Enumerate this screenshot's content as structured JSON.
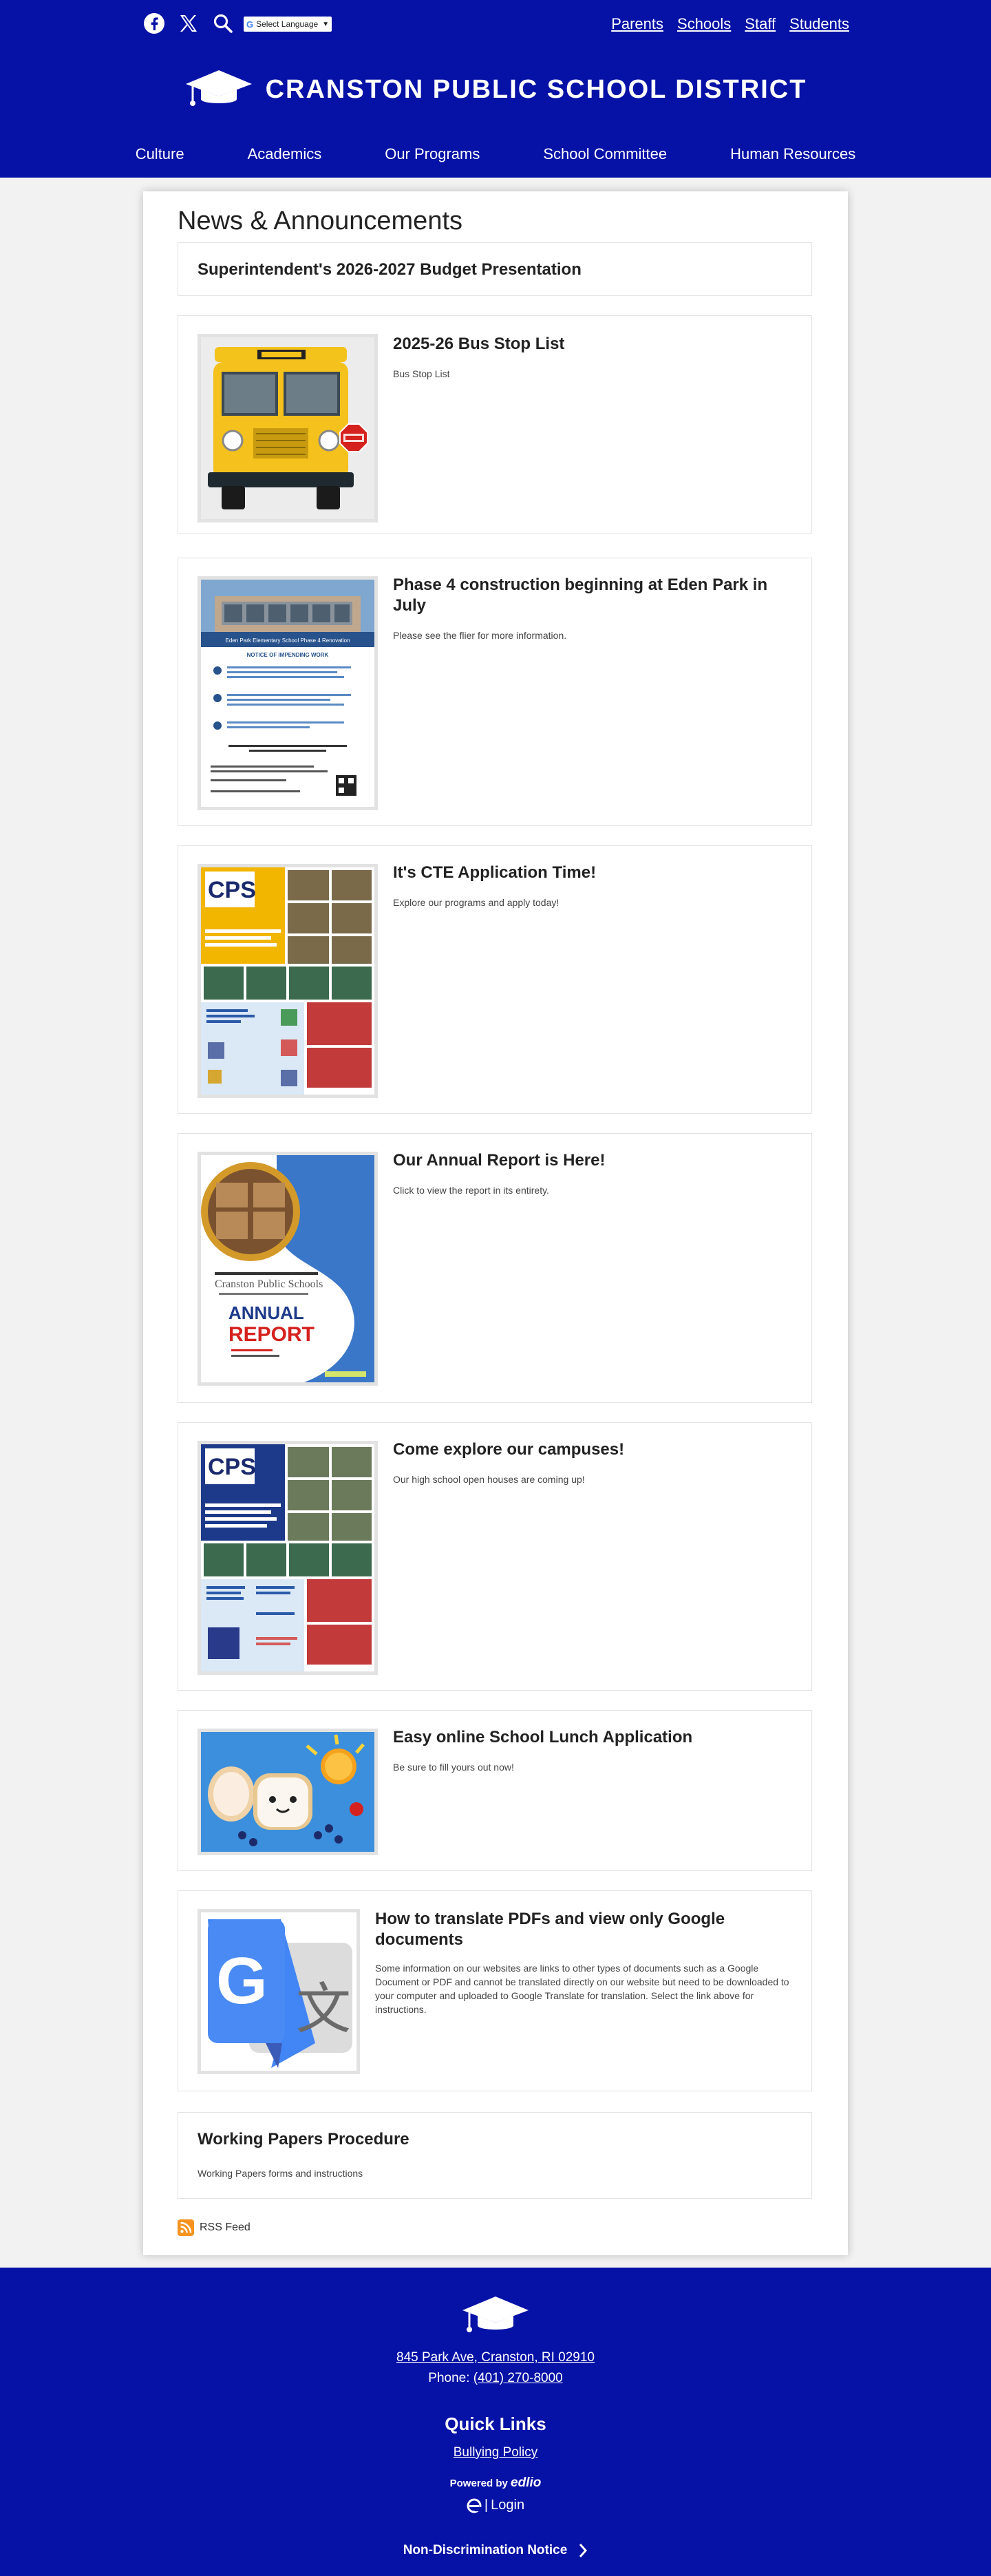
{
  "header": {
    "social": [
      {
        "icon": "facebook-icon"
      },
      {
        "icon": "x-twitter-icon"
      },
      {
        "icon": "search-icon"
      }
    ],
    "translate": {
      "label": "Select Language",
      "icon": "google-translate-icon"
    },
    "top_links": [
      "Parents",
      "Schools",
      "Staff",
      "Students"
    ],
    "title": "CRANSTON PUBLIC SCHOOL DISTRICT",
    "nav": [
      "Culture",
      "Academics",
      "Our Programs",
      "School Committee",
      "Human Resources"
    ],
    "colors": {
      "brand_blue": "#0611a6",
      "white": "#ffffff"
    }
  },
  "main": {
    "title": "News & Announcements",
    "items": [
      {
        "title": "Superintendent's 2026-2027 Budget Presentation",
        "desc": ""
      },
      {
        "title": "2025-26 Bus Stop List",
        "desc": "Bus Stop List",
        "image": "school-bus-image"
      },
      {
        "title": "Phase 4 construction beginning at Eden Park in July",
        "desc": "Please see the flier for more information.",
        "image": "eden-park-flier-image",
        "flier": {
          "heading": "Eden Park Elementary School Phase 4 Renovation",
          "notice": "NOTICE OF IMPENDING WORK"
        }
      },
      {
        "title": "It's CTE Application Time!",
        "desc": "Explore our programs and apply today!",
        "image": "cte-flier-image",
        "flier": {
          "logo": "CPS"
        }
      },
      {
        "title": "Our Annual Report is Here!",
        "desc": "Click to view the report in its entirety.",
        "image": "annual-report-image",
        "flier": {
          "org": "Cranston Public Schools",
          "report": "ANNUAL",
          "report2": "REPORT"
        }
      },
      {
        "title": "Come explore our campuses!",
        "desc": "Our high school open houses are coming up!",
        "image": "campus-flier-image",
        "flier": {
          "logo": "CPS"
        }
      },
      {
        "title": "Easy online School Lunch Application",
        "desc": "Be sure to fill yours out now!",
        "image": "lunch-bread-image"
      },
      {
        "title": "How to translate PDFs and view only Google documents",
        "desc": "Some information on our websites are links to other types of documents such as a Google Document or PDF and cannot be translated directly on our website but need to be downloaded to your computer and uploaded to Google Translate for translation. Select the link above for instructions.",
        "image": "google-translate-logo-image"
      },
      {
        "title": "Working Papers Procedure",
        "desc": "Working Papers forms and instructions"
      }
    ],
    "rss_label": "RSS Feed"
  },
  "footer": {
    "address": "845 Park Ave, Cranston, RI 02910",
    "phone_label": "Phone: ",
    "phone": "(401) 270-8000",
    "quick_links_title": "Quick Links",
    "bullying_policy": "Bullying Policy",
    "powered_by": "Powered by",
    "edlio": "edlio",
    "login": "Login",
    "non_discrimination": "Non-Discrimination Notice"
  }
}
